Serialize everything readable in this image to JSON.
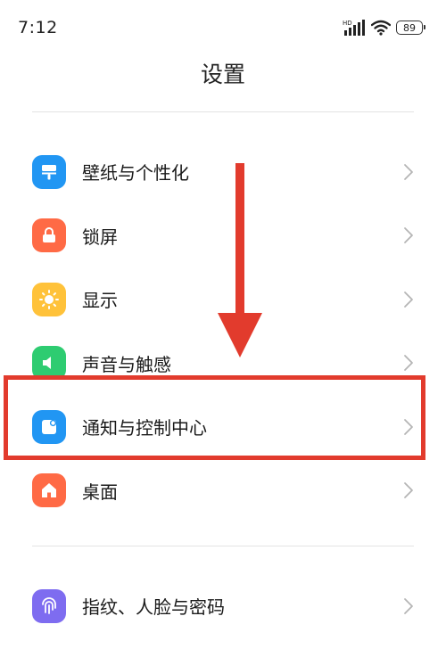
{
  "status_bar": {
    "time": "7:12",
    "network_label": "HD",
    "battery_level": "89"
  },
  "header": {
    "title": "设置"
  },
  "settings": {
    "items": [
      {
        "label": "壁纸与个性化",
        "icon": "wallpaper-icon",
        "color": "#2196F3"
      },
      {
        "label": "锁屏",
        "icon": "lock-icon",
        "color": "#FF6A45"
      },
      {
        "label": "显示",
        "icon": "sun-icon",
        "color": "#FFC23A"
      },
      {
        "label": "声音与触感",
        "icon": "speaker-icon",
        "color": "#2ECC71"
      },
      {
        "label": "通知与控制中心",
        "icon": "notification-icon",
        "color": "#2196F3"
      },
      {
        "label": "桌面",
        "icon": "home-icon",
        "color": "#FF6A45"
      }
    ],
    "items2": [
      {
        "label": "指纹、人脸与密码",
        "icon": "fingerprint-icon",
        "color": "#7E6CF0"
      }
    ]
  },
  "annotation": {
    "highlight_color": "#E23B2D",
    "highlighted_item": "通知与控制中心"
  }
}
